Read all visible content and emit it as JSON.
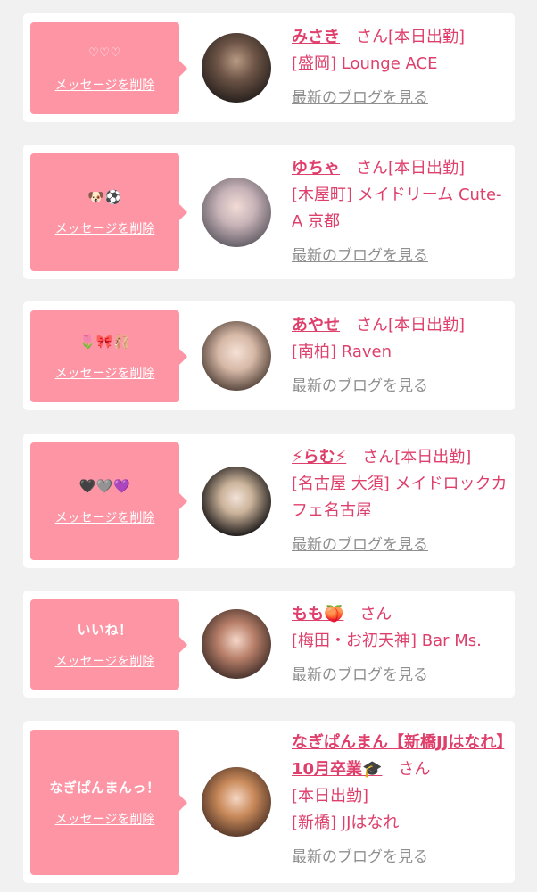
{
  "delete_label": "メッセージを削除",
  "blog_label": "最新のブログを見る",
  "san_label": "さん",
  "cards": [
    {
      "message": "♡♡♡",
      "name": "みさき",
      "status": "[本日出勤]",
      "shop": "[盛岡] Lounge ACE"
    },
    {
      "message": "🐶⚽",
      "name": "ゆちゃ",
      "status": "[本日出勤]",
      "shop": "[木屋町] メイドリーム Cute-A 京都"
    },
    {
      "message": "🌷🎀🩰",
      "name": "あやせ",
      "status": "[本日出勤]",
      "shop": "[南柏] Raven"
    },
    {
      "message": "🖤🩶💜",
      "name": "⚡らむ⚡",
      "status": "[本日出勤]",
      "shop": "[名古屋 大須] メイドロックカフェ名古屋"
    },
    {
      "message": "いいね！",
      "name": "もも🍑",
      "status": "",
      "shop": "[梅田・お初天神] Bar Ms."
    },
    {
      "message": "なぎぱんまんっ！",
      "name": "なぎぱんまん【新橋JJはなれ】10月卒業🎓",
      "status": "[本日出勤]",
      "shop": "[新橋] JJはなれ"
    }
  ],
  "colors": {
    "accent": "#de3f6b",
    "bubble": "#fd95a5",
    "background": "#f1f1f1",
    "muted": "#8f8f8f"
  }
}
